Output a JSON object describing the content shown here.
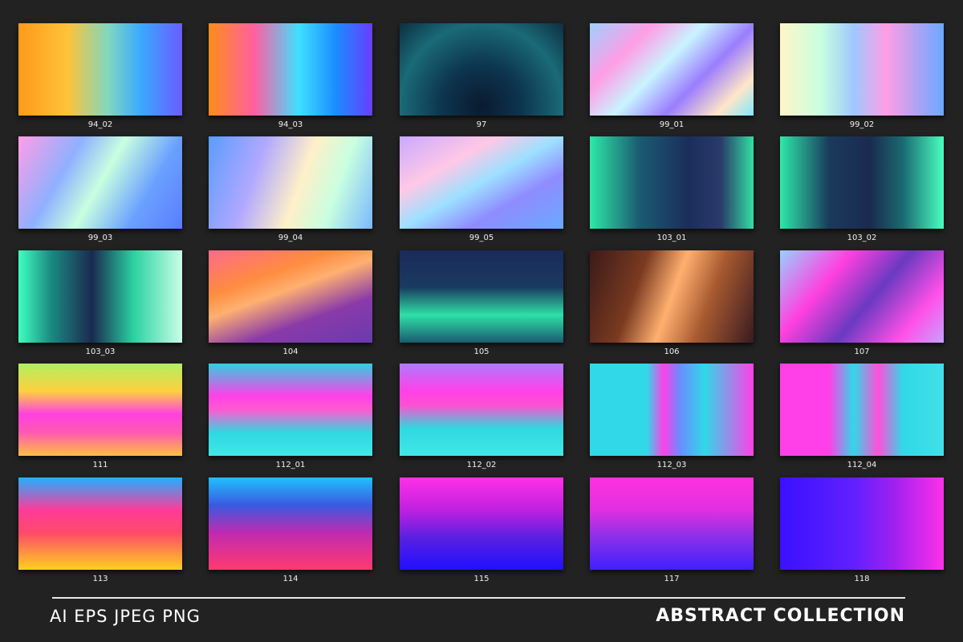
{
  "tiles": [
    {
      "label": "94_02",
      "bg": "linear-gradient(90deg,#ff9a1a 0%,#ffc23a 30%,#7fd8c0 55%,#3aa8ff 75%,#6a5cff 100%)"
    },
    {
      "label": "94_03",
      "bg": "linear-gradient(90deg,#ff8c1a 0%,#ff5fa0 28%,#3fe0ff 55%,#1a8cff 78%,#6a3cff 100%)"
    },
    {
      "label": "97",
      "bg": "radial-gradient(ellipse at 50% 90%,#0a1a2e 0%,#0d3550 35%,#1a6a78 70%,#0d2e40 100%)"
    },
    {
      "label": "99_01",
      "bg": "linear-gradient(135deg,#9fd0ff 0%,#ff9de6 25%,#c8f4ff 45%,#9a7dff 65%,#ffe6c8 85%,#7fe8ff 100%)"
    },
    {
      "label": "99_02",
      "bg": "linear-gradient(90deg,#fff5c8 0%,#c8ffe0 25%,#9fc8ff 45%,#ff9de6 65%,#6aa8ff 100%)"
    },
    {
      "label": "99_03",
      "bg": "linear-gradient(120deg,#ff9de6 0%,#8fb0ff 30%,#c8ffe0 50%,#6aa0ff 75%,#5a7dff 100%)"
    },
    {
      "label": "99_04",
      "bg": "linear-gradient(110deg,#5a9cff 0%,#b0a8ff 30%,#fff0c8 55%,#c8ffe0 75%,#7ab8ff 100%)"
    },
    {
      "label": "99_05",
      "bg": "linear-gradient(150deg,#c8a8ff 0%,#ffc8e6 30%,#9de0ff 50%,#8f8cff 70%,#6aa8ff 100%)"
    },
    {
      "label": "103_01",
      "bg": "linear-gradient(90deg,#2ee8a8 0%,#1a5c70 30%,#1a2e5c 60%,#2a3a6a 80%,#30e0a0 100%)"
    },
    {
      "label": "103_02",
      "bg": "linear-gradient(90deg,#2ee8a8 0%,#1a3a5c 30%,#1a2a50 55%,#1a6a70 75%,#4affc0 100%)"
    },
    {
      "label": "103_03",
      "bg": "linear-gradient(90deg,#40ffc0 0%,#1a8a80 20%,#1a2a50 45%,#2ad0a0 70%,#c8ffe8 100%)"
    },
    {
      "label": "104",
      "bg": "linear-gradient(160deg,#ff6a8a 0%,#ff8c40 30%,#ffb070 45%,#8a3aa8 70%,#6a3ab0 100%)"
    },
    {
      "label": "105",
      "bg": "linear-gradient(180deg,#1a2a5c 0%,#1a3a60 40%,#2ee0a8 70%,#1a5a70 100%)"
    },
    {
      "label": "106",
      "bg": "linear-gradient(110deg,#3a1a1a 0%,#7a3a20 30%,#ffb070 50%,#a85a30 70%,#3a1a20 100%)"
    },
    {
      "label": "107",
      "bg": "linear-gradient(130deg,#9ad0ff 0%,#ff40e0 30%,#6a3ac0 55%,#ff50e8 80%,#c8a0ff 100%)"
    },
    {
      "label": "111",
      "bg": "linear-gradient(180deg,#b0f060 0%,#ffd040 30%,#ff40e0 55%,#ff5ab0 75%,#ffc040 100%)"
    },
    {
      "label": "112_01",
      "bg": "linear-gradient(180deg,#30d0e0 0%,#ff40e8 35%,#ff5ad0 50%,#30d8e0 75%,#40e8e8 100%)"
    },
    {
      "label": "112_02",
      "bg": "linear-gradient(180deg,#b07aff 0%,#ff40e8 30%,#ff50d0 45%,#30d8e0 70%,#40e8e8 100%)"
    },
    {
      "label": "112_03",
      "bg": "linear-gradient(90deg,#30d8e8 0%,#30d8e8 35%,#ff40e8 45%,#6a8cff 55%,#30d8e8 70%,#ff40e8 100%)"
    },
    {
      "label": "112_04",
      "bg": "linear-gradient(90deg,#ff40e8 0%,#ff40e8 30%,#30d8e8 45%,#ff50d8 60%,#30d8e8 75%,#40e0e8 100%)"
    },
    {
      "label": "113",
      "bg": "linear-gradient(180deg,#20b0ff 0%,#ff3a9a 35%,#ff4a6a 60%,#ffd020 100%)"
    },
    {
      "label": "114",
      "bg": "linear-gradient(180deg,#20c0ff 0%,#3a5ae0 30%,#c02ab0 60%,#ff3a70 100%)"
    },
    {
      "label": "115",
      "bg": "linear-gradient(180deg,#ff30e8 0%,#c020e0 35%,#5a20e0 65%,#2010ff 100%)"
    },
    {
      "label": "117",
      "bg": "linear-gradient(180deg,#ff30e0 0%,#e030e0 35%,#8a30e8 65%,#4020ff 100%)"
    },
    {
      "label": "118",
      "bg": "linear-gradient(90deg,#3a10ff 0%,#6020ff 45%,#a020f0 70%,#ff30e8 100%)"
    }
  ],
  "footer": {
    "formats": "AI EPS JPEG PNG",
    "collection": "ABSTRACT COLLECTION"
  }
}
